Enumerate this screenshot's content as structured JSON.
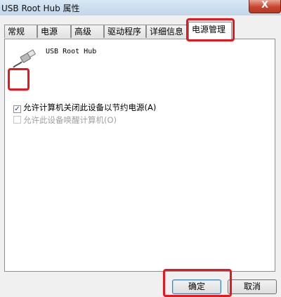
{
  "window": {
    "title": "USB Root Hub 属性",
    "close_glyph": "X"
  },
  "tabs": [
    {
      "label": "常规"
    },
    {
      "label": "电源"
    },
    {
      "label": "高级"
    },
    {
      "label": "驱动程序"
    },
    {
      "label": "详细信息"
    },
    {
      "label": "电源管理",
      "active": true
    }
  ],
  "panel": {
    "device_name": "USB Root Hub",
    "device_icon": "usb-plug-icon",
    "checkbox_allow_off": {
      "label": "允许计算机关闭此设备以节约电源(A)",
      "checked": true,
      "enabled": true
    },
    "checkbox_wake": {
      "label": "允许此设备唤醒计算机(O)",
      "checked": false,
      "enabled": false
    }
  },
  "buttons": {
    "ok_label": "确定",
    "cancel_label": "取消"
  },
  "annotation_color": "#e8171d",
  "check_glyph": "✓"
}
